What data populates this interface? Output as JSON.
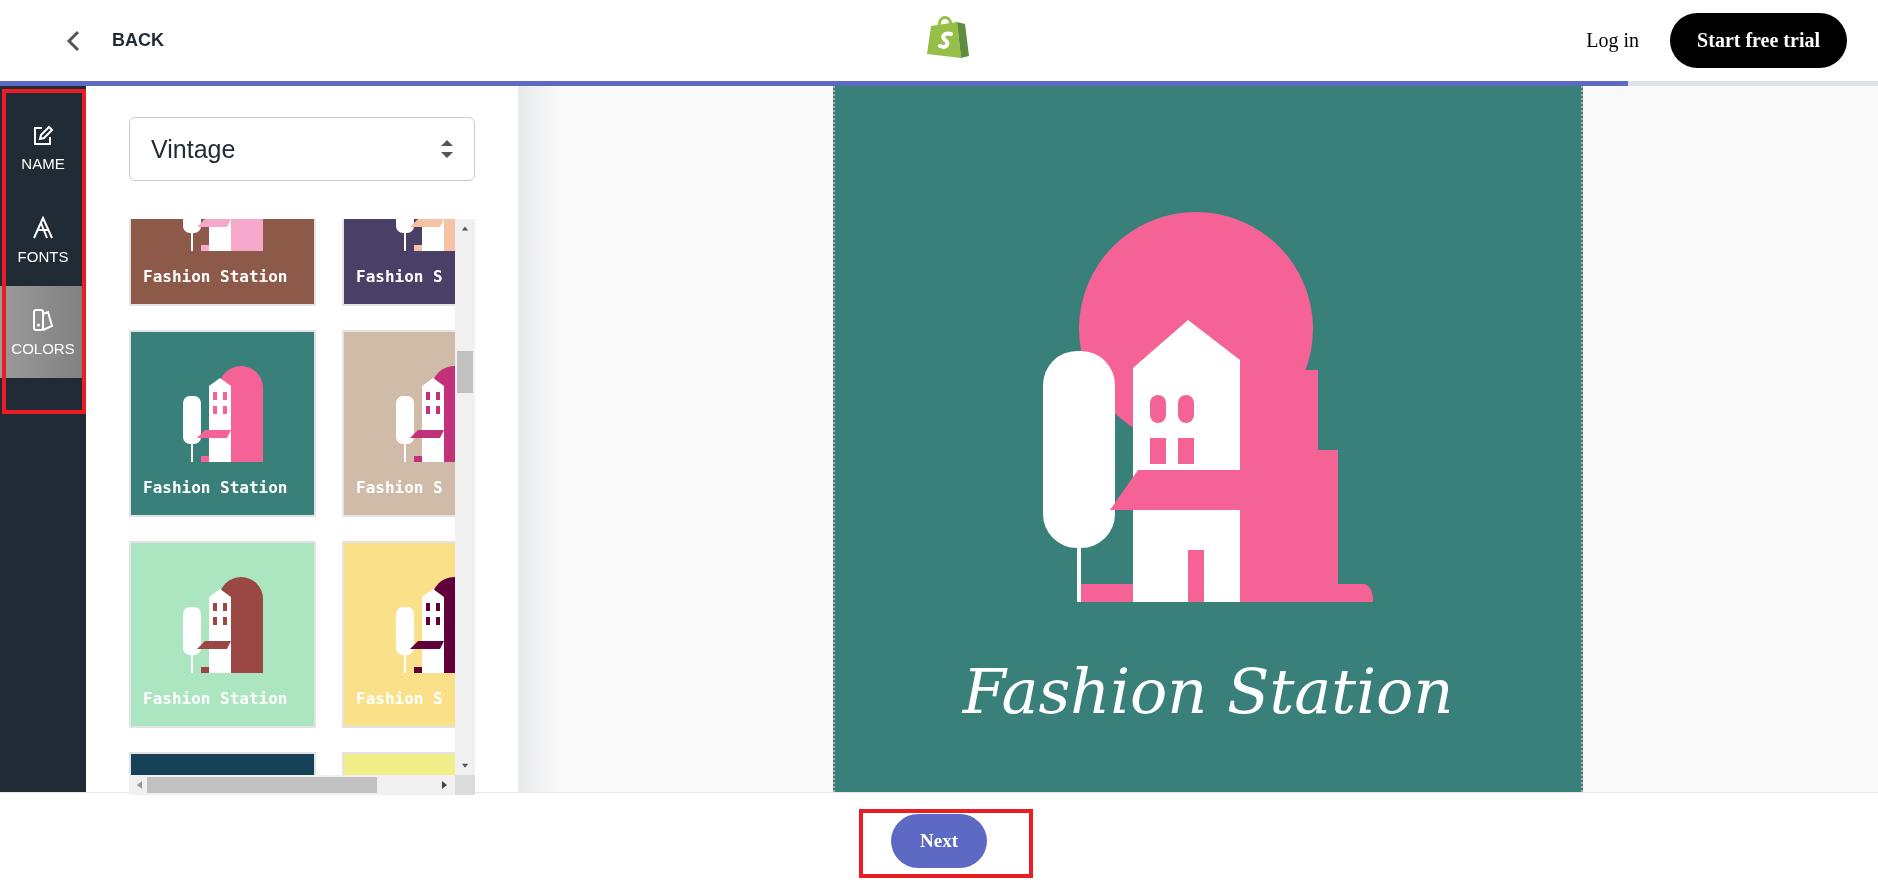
{
  "header": {
    "back_label": "BACK",
    "login": "Log in",
    "cta": "Start free trial"
  },
  "progress": {
    "level": 0.867
  },
  "sidebar": {
    "items": [
      {
        "label": "NAME",
        "kind": "name",
        "selected": false
      },
      {
        "label": "FONTS",
        "kind": "fonts",
        "selected": false
      },
      {
        "label": "COLORS",
        "kind": "colors",
        "selected": true
      }
    ]
  },
  "style_select": {
    "value": "Vintage"
  },
  "palettes": [
    {
      "color": "#8d5a4a",
      "illustration": {
        "color": "#f6a8cb"
      },
      "text": "Fashion Station"
    },
    {
      "color": "#4a3f66",
      "illustration": {
        "color": "#f7c2a3"
      },
      "text": "Fashion S"
    },
    {
      "color": "#39807a",
      "illustration": {
        "color": "#f56396"
      },
      "text": "Fashion Station"
    },
    {
      "color": "#d0bba8",
      "illustration": {
        "color": "#c2317a"
      },
      "text": "Fashion S"
    },
    {
      "color": "#ace6c0",
      "illustration": {
        "color": "#9b4744"
      },
      "text": "Fashion Station"
    },
    {
      "color": "#fae088",
      "illustration": {
        "color": "#62003a"
      },
      "text": "Fashion S"
    },
    {
      "color": "#164157"
    },
    {
      "color": "#f0ef8a"
    }
  ],
  "preview": {
    "title": "Fashion Station"
  },
  "next_button": "Next"
}
